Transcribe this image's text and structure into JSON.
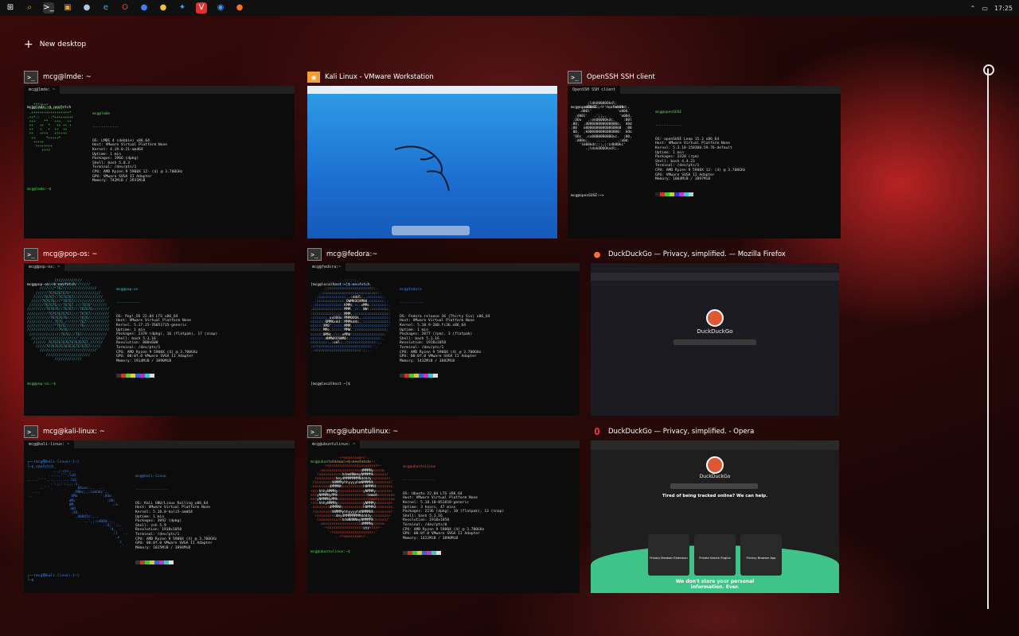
{
  "taskbar": {
    "icons": [
      {
        "name": "windows-start-icon",
        "glyph": "⊞",
        "color": "#ffffff",
        "bg": "transparent"
      },
      {
        "name": "search-icon",
        "glyph": "⌕",
        "color": "#e0a030",
        "bg": "transparent"
      },
      {
        "name": "terminal-icon",
        "glyph": ">_",
        "color": "#ffffff",
        "bg": "#333333"
      },
      {
        "name": "vmware-icon",
        "glyph": "▣",
        "color": "#f0a030",
        "bg": "transparent"
      },
      {
        "name": "chrome-circle-icon",
        "glyph": "●",
        "color": "#b0c8e8",
        "bg": "transparent"
      },
      {
        "name": "edge-icon",
        "glyph": "e",
        "color": "#3fb0e8",
        "bg": "transparent"
      },
      {
        "name": "opera-icon",
        "glyph": "O",
        "color": "#ff3344",
        "bg": "transparent"
      },
      {
        "name": "firefox-dev-icon",
        "glyph": "●",
        "color": "#3f80ff",
        "bg": "transparent"
      },
      {
        "name": "yellow-app-icon",
        "glyph": "●",
        "color": "#f0c040",
        "bg": "transparent"
      },
      {
        "name": "blue-bird-icon",
        "glyph": "✦",
        "color": "#3f9cff",
        "bg": "transparent"
      },
      {
        "name": "vivaldi-icon",
        "glyph": "V",
        "color": "#ffffff",
        "bg": "#e03030"
      },
      {
        "name": "safari-icon",
        "glyph": "◉",
        "color": "#3fa0ff",
        "bg": "transparent"
      },
      {
        "name": "firefox-icon",
        "glyph": "●",
        "color": "#ff7020",
        "bg": "transparent"
      }
    ],
    "chevron_glyph": "⌃",
    "time": "17:25"
  },
  "new_desktop_label": "New desktop",
  "windows": [
    {
      "title": "mcg@lmde: ~",
      "tab": "mcg@lmde: ~",
      "command": "mcg@lmde:~$ neofetch",
      "logo_color": "#5fd35f",
      "header_color": "#5fd35f",
      "header": "mcg@lmde",
      "info": "OS: LMDE 4 (debbie) x86_64\nHost: VMware Virtual Platform None\nKernel: 4.19.0-21-amd64\nUptime: 1 min\nPackages: 1966 (dpkg)\nShell: bash 5.0.3\nTerminal: /dev/pts/1\nCPU: AMD Ryzen 9 5900X 12- (4) @ 3.700GHz\nGPU: VMware SVGA II Adapter\nMemory: 742MiB / 3931MiB",
      "final_prompt": "mcg@lmde:~$"
    },
    {
      "title": "Kali Linux - VMware Workstation"
    },
    {
      "title": "OpenSSH SSH client",
      "tab": "OpenSSH SSH client",
      "command": "mcg@openSUSE:~> neofetch",
      "logo_color": "#ffffff",
      "header_color": "#5fd35f",
      "header": "mcg@openSUSE",
      "info": "OS: openSUSE Leap 15.3 x86_64\nHost: VMware Virtual Platform None\nKernel: 5.3.18-150300.59.76-default\nUptime: 1 min\nPackages: 2420 (rpm)\nShell: bash 4.4.23\nTerminal: /dev/pts/1\nCPU: AMD Ryzen 9 5900X 12- (4) @ 3.700GHz\nGPU: VMware SVGA II Adapter\nMemory: 1064MiB / 3897MiB",
      "final_prompt": "mcg@openSUSE:~>"
    },
    {
      "title": "mcg@pop-os: ~",
      "tab": "mcg@pop-os: ~",
      "command": "mcg@pop-os:~$ neofetch",
      "logo_color": "#48b9c7",
      "header_color": "#48b9c7",
      "header": "mcg@pop-os",
      "info": "OS: Pop!_OS 22.04 LTS x86_64\nHost: VMware Virtual Platform None\nKernel: 5.17.15-76051715-generic\nUptime: 1 min\nPackages: 2370 (dpkg), 16 (flatpak), 17 (snap)\nShell: bash 5.1.16\nResolution: 800x600\nTerminal: /dev/pts/1\nCPU: AMD Ryzen 9 5900X (4) @ 3.700GHz\nGPU: 00:0f.0 VMware SVGA II Adapter\nMemory: 1914MiB / 3890MiB",
      "final_prompt": "mcg@pop-os:~$"
    },
    {
      "title": "mcg@fedora:~",
      "tab": "mcg@fedora:~",
      "command": "[mcg@localhost ~]$ neofetch",
      "logo_color": "#3f7fdf",
      "header_color": "#3f7fdf",
      "header": "mcg@fedora",
      "info": "OS: Fedora release 36 (Thirty Six) x86_64\nHost: VMware Virtual Platform None\nKernel: 5.18.9-200.fc36.x86_64\nUptime: 1 min\nPackages: 2077 (rpm), 3 (flatpak)\nShell: bash 5.1.16\nResolution: 1918x1058\nTerminal: /dev/pts/1\nCPU: AMD Ryzen 9 5900X (4) @ 3.700GHz\nGPU: 00:0f.0 VMware SVGA II Adapter\nMemory: 1412MiB / 3882MiB",
      "final_prompt": "[mcg@localhost ~]$"
    },
    {
      "title": "DuckDuckGo — Privacy, simplified. — Mozilla Firefox",
      "brand": "DuckDuckGo"
    },
    {
      "title": "mcg@kali-linux: ~",
      "tab": "mcg@kali-linux: ~",
      "command": "┌──(mcg㉿kali-linux)-[~]\n└─$ neofetch",
      "logo_color": "#3f80e8",
      "header_color": "#3f80e8",
      "header": "mcg@kali-linux",
      "info": "OS: Kali GNU/Linux Rolling x86_64\nHost: VMware Virtual Platform None\nKernel: 5.18.0-kali5-amd64\nUptime: 1 min\nPackages: 3092 (dpkg)\nShell: zsh 5.9\nResolution: 1918x1050\nTerminal: /dev/pts/1\nCPU: AMD Ryzen 9 5900X (4) @ 3.700GHz\nGPU: 00:0f.0 VMware SVGA II Adapter\nMemory: 1015MiB / 3894MiB",
      "final_prompt": "┌──(mcg㉿kali-linux)-[~]\n└─$"
    },
    {
      "title": "mcg@ubuntulinux: ~",
      "tab": "mcg@ubuntulinux: ~",
      "command": "mcg@ubuntulinux:~$ neofetch",
      "logo_color": "#e0482c",
      "header_color": "#e0482c",
      "header": "mcg@ubuntulinux",
      "info": "OS: Ubuntu 22.04 LTS x86_64\nHost: VMware Virtual Platform None\nKernel: 5.18.10-051810-generic\nUptime: 3 hours, 47 mins\nPackages: 2236 (dpkg), 10 (flatpak), 13 (snap)\nShell: bash 5.1.16\nResolution: 1918x1050\nTerminal: /dev/pts/0\nCPU: AMD Ryzen 9 5900X (4) @ 3.700GHz\nGPU: 00:0f.0 VMware SVGA II Adapter\nMemory: 1422MiB / 3890MiB",
      "final_prompt": "mcg@ubuntulinux:~$"
    },
    {
      "title": "DuckDuckGo — Privacy, simplified. - Opera",
      "brand": "DuckDuckGo",
      "headline": "Tired of being tracked online? We can help.",
      "cards": [
        "Privacy Browser Extension",
        "Private Search Engine",
        "Privacy Browser App"
      ],
      "tagline": "We don't store your personal information. Ever."
    }
  ]
}
